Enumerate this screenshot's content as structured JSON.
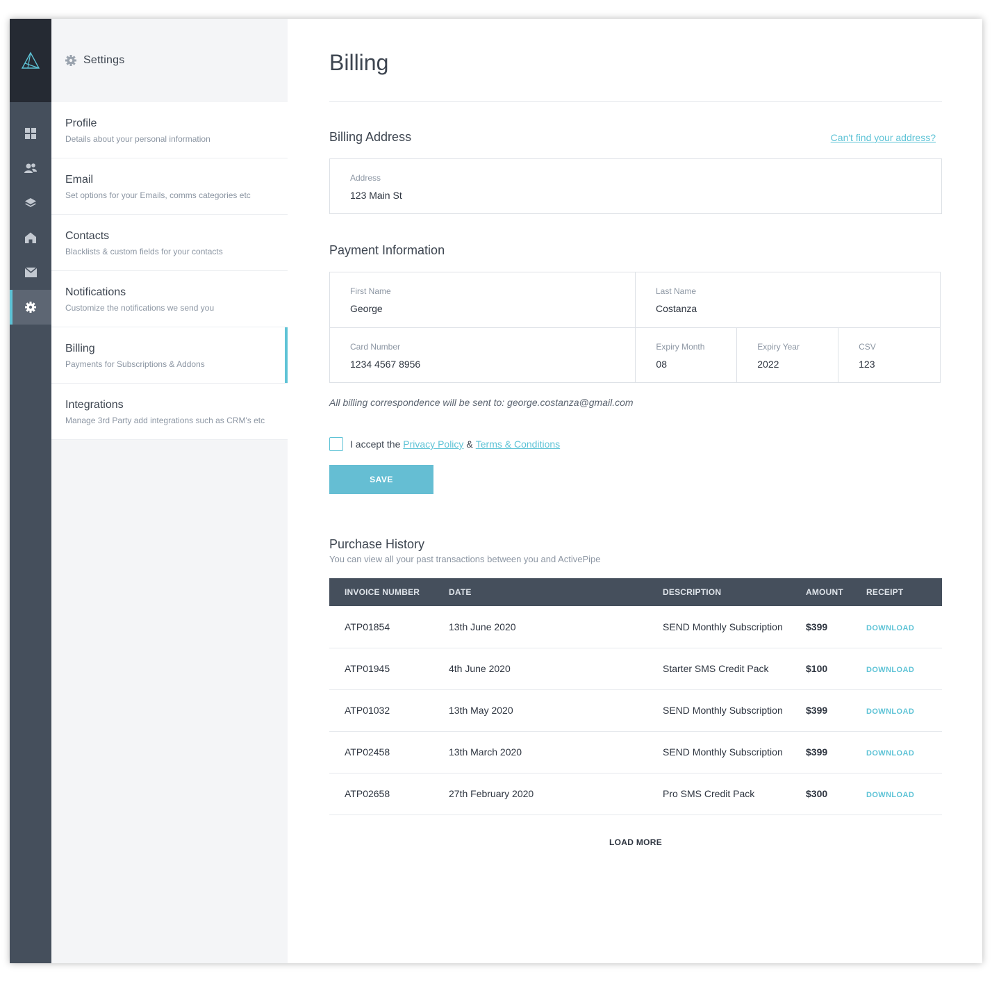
{
  "colors": {
    "accent": "#5ec3d6",
    "rail_bg": "#454f5c",
    "rail_logo_bg": "#252a33",
    "table_header_bg": "#454f5c",
    "button_bg": "#65bed3"
  },
  "rail": {
    "logo_icon": "activepipe-logo-icon",
    "items": [
      {
        "icon": "dashboard-grid-icon",
        "active": false
      },
      {
        "icon": "contacts-people-icon",
        "active": false
      },
      {
        "icon": "layers-icon",
        "active": false
      },
      {
        "icon": "home-icon",
        "active": false
      },
      {
        "icon": "mail-envelope-icon",
        "active": false
      },
      {
        "icon": "settings-gear-icon",
        "active": true
      }
    ]
  },
  "subnav": {
    "title": "Settings",
    "items": [
      {
        "label": "Profile",
        "desc": "Details about your personal information",
        "active": false
      },
      {
        "label": "Email",
        "desc": "Set options for your Emails, comms categories etc",
        "active": false
      },
      {
        "label": "Contacts",
        "desc": "Blacklists & custom fields for your contacts",
        "active": false
      },
      {
        "label": "Notifications",
        "desc": "Customize the notifications we send you",
        "active": false
      },
      {
        "label": "Billing",
        "desc": "Payments for Subscriptions & Addons",
        "active": true
      },
      {
        "label": "Integrations",
        "desc": "Manage 3rd Party add integrations such as CRM's etc",
        "active": false
      }
    ]
  },
  "page": {
    "title": "Billing"
  },
  "billing_address": {
    "title": "Billing Address",
    "help_link": "Can't find your address?",
    "address_label": "Address",
    "address_value": "123 Main St"
  },
  "payment": {
    "title": "Payment Information",
    "first_name_label": "First Name",
    "first_name_value": "George",
    "last_name_label": "Last Name",
    "last_name_value": "Costanza",
    "card_label": "Card Number",
    "card_value": "1234 4567 8956",
    "expiry_month_label": "Expiry Month",
    "expiry_month_value": "08",
    "expiry_year_label": "Expiry Year",
    "expiry_year_value": "2022",
    "csv_label": "CSV",
    "csv_value": "123",
    "note": "All billing correspondence will be sent to: george.costanza@gmail.com"
  },
  "consent": {
    "prefix": "I accept the",
    "privacy_link": "Privacy Policy",
    "amp": "&",
    "terms_link": "Terms & Conditions",
    "checked": false
  },
  "save_label": "SAVE",
  "history": {
    "title": "Purchase History",
    "subtitle": "You can view all your past transactions between you and ActivePipe",
    "headers": [
      "INVOICE NUMBER",
      "DATE",
      "DESCRIPTION",
      "AMOUNT",
      "RECEIPT"
    ],
    "rows": [
      {
        "invoice": "ATP01854",
        "date": "13th June 2020",
        "description": "SEND Monthly Subscription",
        "amount": "$399",
        "receipt": "DOWNLOAD"
      },
      {
        "invoice": "ATP01945",
        "date": "4th June 2020",
        "description": "Starter SMS Credit Pack",
        "amount": "$100",
        "receipt": "DOWNLOAD"
      },
      {
        "invoice": "ATP01032",
        "date": "13th May 2020",
        "description": "SEND Monthly Subscription",
        "amount": "$399",
        "receipt": "DOWNLOAD"
      },
      {
        "invoice": "ATP02458",
        "date": "13th March 2020",
        "description": "SEND Monthly Subscription",
        "amount": "$399",
        "receipt": "DOWNLOAD"
      },
      {
        "invoice": "ATP02658",
        "date": "27th February 2020",
        "description": "Pro SMS Credit Pack",
        "amount": "$300",
        "receipt": "DOWNLOAD"
      }
    ],
    "load_more": "LOAD MORE"
  }
}
